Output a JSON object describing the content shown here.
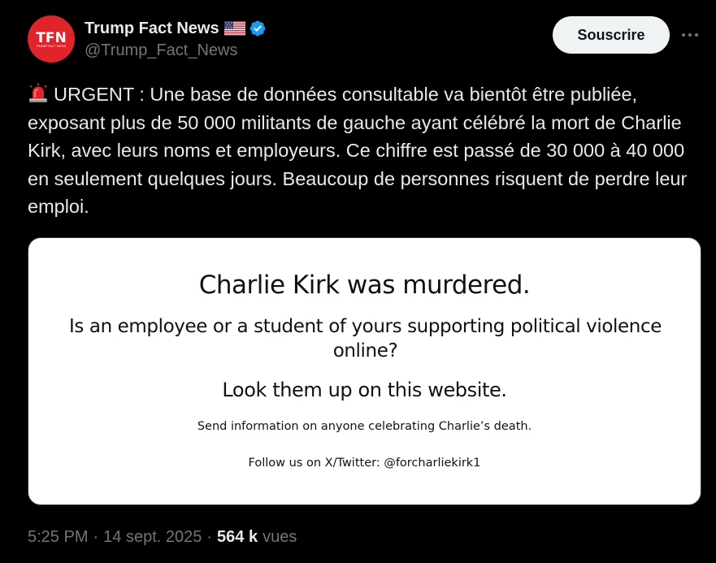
{
  "author": {
    "display_name": "Trump Fact News",
    "handle": "@Trump_Fact_News",
    "avatar_logo_text": "TFN",
    "avatar_logo_subtext": "TRUMP FACT NEWS",
    "verified": true
  },
  "subscribe_label": "Souscrire",
  "tweet": {
    "text": "URGENT : Une base de données consultable va bientôt être publiée, exposant plus de 50 000 militants de gauche ayant célébré la mort de Charlie Kirk, avec leurs noms et employeurs. Ce chiffre est passé de 30 000 à 40 000 en seulement quelques jours. Beaucoup de personnes risquent de perdre leur emploi."
  },
  "media": {
    "title": "Charlie Kirk was murdered.",
    "question": "Is an employee or a student of yours supporting political violence online?",
    "lookup": "Look them up on this website.",
    "send_info": "Send information on anyone celebrating Charlie’s death.",
    "follow": "Follow us on X/Twitter: @forcharliekirk1"
  },
  "meta": {
    "time": "5:25 PM",
    "separator": "·",
    "date": "14 sept. 2025",
    "views_count": "564 k",
    "views_label": "vues"
  },
  "icons": {
    "more": "more-icon",
    "verified": "verified-badge-icon",
    "flag": "us-flag-icon",
    "siren": "siren-icon"
  },
  "colors": {
    "background": "#000000",
    "text_primary": "#e7e9ea",
    "text_secondary": "#71767b",
    "verified_blue": "#1d9bf0",
    "avatar_red": "#e0242b",
    "button_bg": "#eff3f4"
  }
}
